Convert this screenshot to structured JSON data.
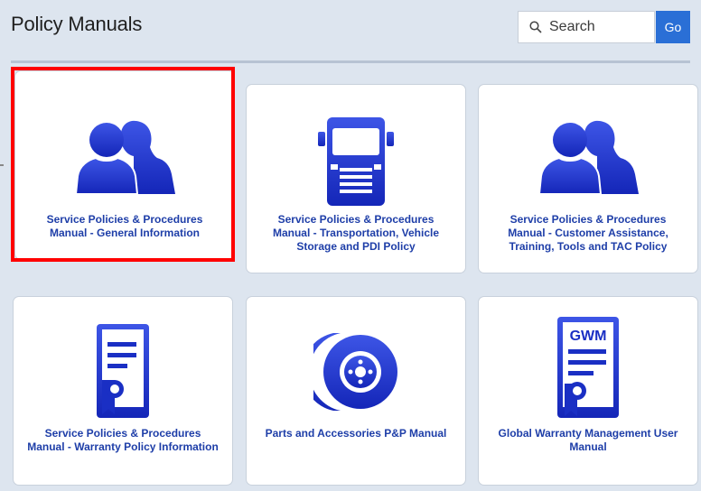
{
  "header": {
    "title": "Policy Manuals",
    "search_placeholder": "Search",
    "go_label": "Go"
  },
  "tiles": [
    {
      "label": "Service Policies & Procedures Manual - General Information",
      "icon": "people-icon"
    },
    {
      "label": "Service Policies & Procedures Manual - Transportation, Vehicle Storage and PDI Policy",
      "icon": "truck-icon"
    },
    {
      "label": "Service Policies & Procedures Manual - Customer Assistance, Training, Tools and TAC Policy",
      "icon": "people-icon"
    },
    {
      "label": "Service Policies & Procedures Manual - Warranty Policy Information",
      "icon": "certificate-icon"
    },
    {
      "label": "Parts and Accessories P&P Manual",
      "icon": "brake-disc-icon"
    },
    {
      "label": "Global Warranty Management User Manual",
      "icon": "gwm-certificate-icon",
      "icon_text": "GWM"
    }
  ],
  "colors": {
    "icon_blue": "#1a2fc4",
    "label_blue": "#1e3ea8",
    "go_button": "#2a6fd6",
    "highlight": "#ff0000"
  }
}
